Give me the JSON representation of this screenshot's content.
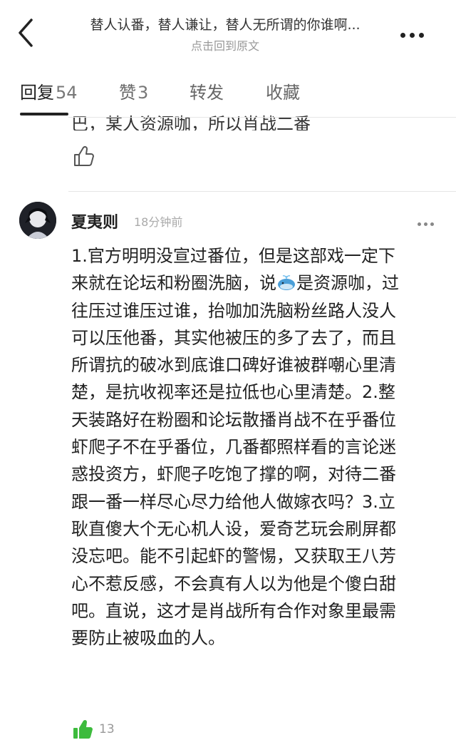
{
  "header": {
    "title": "替人认番，替人谦让，替人无所谓的你谁啊...",
    "subtitle": "点击回到原文",
    "back_icon": "chevron-left-icon",
    "more_icon": "more-dots-icon"
  },
  "tabs": [
    {
      "label": "回复",
      "count": "54",
      "active": true
    },
    {
      "label": "赞",
      "count": "3",
      "active": false
    },
    {
      "label": "转发",
      "count": "",
      "active": false
    },
    {
      "label": "收藏",
      "count": "",
      "active": false
    }
  ],
  "previous_comment": {
    "partial_text": "巴，某人资源咖，所以肖战二番",
    "like_icon": "thumbs-up-outline-icon"
  },
  "comment": {
    "username": "夏夷则",
    "time": "18分钟前",
    "emoji_icon": "whale-emoji-icon",
    "lines": [
      "1.官方明明没宣过番位，但是这部戏一定下",
      "来就在论坛和粉圈洗脑，说",
      "往压过谁压过谁，抬咖加洗脑粉丝路人没人",
      "可以压他番，其实他被压的多了去了，而且",
      "所谓抗的破冰到底谁口碑好谁被群嘲心里清",
      "楚，是抗收视率还是拉低也心里清楚。2.整",
      "天装路好在粉圈和论坛散播肖战不在乎番位",
      "虾爬子不在乎番位，几番都照样看的言论迷",
      "惑投资方，虾爬子吃饱了撑的啊，对待二番",
      "跟一番一样尽心尽力给他人做嫁衣吗？3.立",
      "耿直傻大个无心机人设，爱奇艺玩会刷屏都",
      "没忘吧。能不引起虾的警惕，又获取王八芳",
      "心不惹反感，不会真有人以为他是个傻白甜",
      "吧。直说，这才是肖战所有合作对象里最需",
      "要防止被吸血的人。"
    ],
    "line2_after_emoji": "是资源咖，过",
    "like_count": "13",
    "like_icon": "thumbs-up-filled-icon",
    "like_color": "#3dbb3d"
  }
}
